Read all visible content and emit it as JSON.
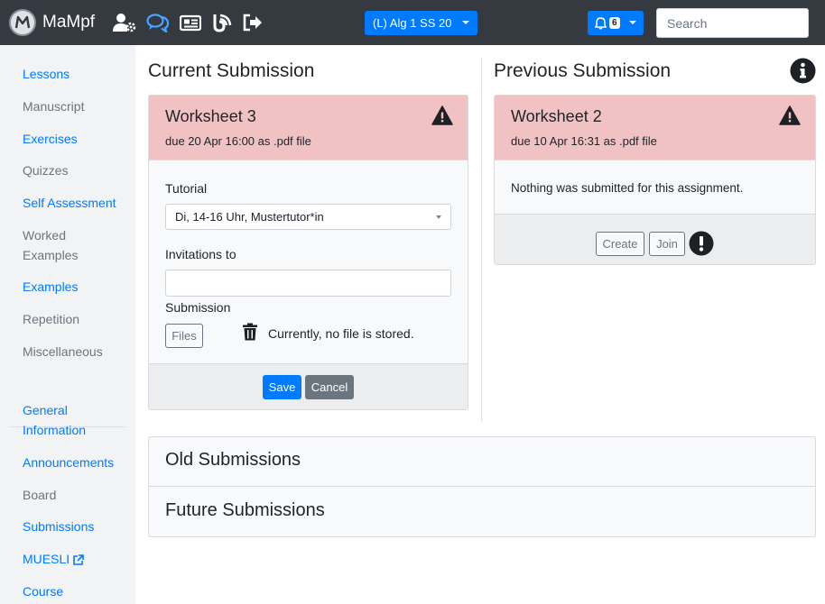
{
  "navbar": {
    "brand": "MaMpf",
    "icons": [
      "user-cog-icon",
      "comments-icon",
      "newspaper-icon",
      "blog-icon",
      "sign-out-icon"
    ],
    "lecture_selector": "(L) Alg 1 SS 20",
    "notification_count": "6",
    "search_placeholder": "Search"
  },
  "sidebar": {
    "items": [
      {
        "label": "Lessons",
        "style": "link"
      },
      {
        "label": "Manuscript",
        "style": "muted"
      },
      {
        "label": "Exercises",
        "style": "link"
      },
      {
        "label": "Quizzes",
        "style": "muted"
      },
      {
        "label": "Self Assessment",
        "style": "link"
      },
      {
        "label": "Worked Examples",
        "style": "muted"
      },
      {
        "label": "Examples",
        "style": "link"
      },
      {
        "label": "Repetition",
        "style": "muted"
      },
      {
        "label": "Miscellaneous",
        "style": "muted"
      },
      {
        "label": "General Information",
        "style": "link"
      },
      {
        "label": "Announcements",
        "style": "link"
      },
      {
        "label": "Board",
        "style": "muted"
      },
      {
        "label": "Submissions",
        "style": "link"
      },
      {
        "label": "MUESLI",
        "style": "link"
      },
      {
        "label": "Course",
        "style": "link"
      }
    ]
  },
  "current": {
    "heading": "Current Submission",
    "title": "Worksheet 3",
    "due": "due 20 Apr 16:00 as .pdf file",
    "tutorial_label": "Tutorial",
    "tutorial_value": "Di, 14-16 Uhr, Mustertutor*in",
    "invitations_label": "Invitations to",
    "invitations_value": "",
    "submission_label": "Submission",
    "files_button": "Files",
    "file_status": "Currently, no file is stored.",
    "save_button": "Save",
    "cancel_button": "Cancel"
  },
  "previous": {
    "heading": "Previous Submission",
    "title": "Worksheet 2",
    "due": "due 10 Apr 16:31 as .pdf file",
    "message": "Nothing was submitted for this assignment.",
    "create_button": "Create",
    "join_button": "Join"
  },
  "accordion": {
    "old": "Old Submissions",
    "future": "Future Submissions"
  },
  "colors": {
    "navbar": "#343a40",
    "primary": "#007bff",
    "danger_light": "#f0c2c3",
    "sidebar_bg": "#f1f3f5"
  }
}
